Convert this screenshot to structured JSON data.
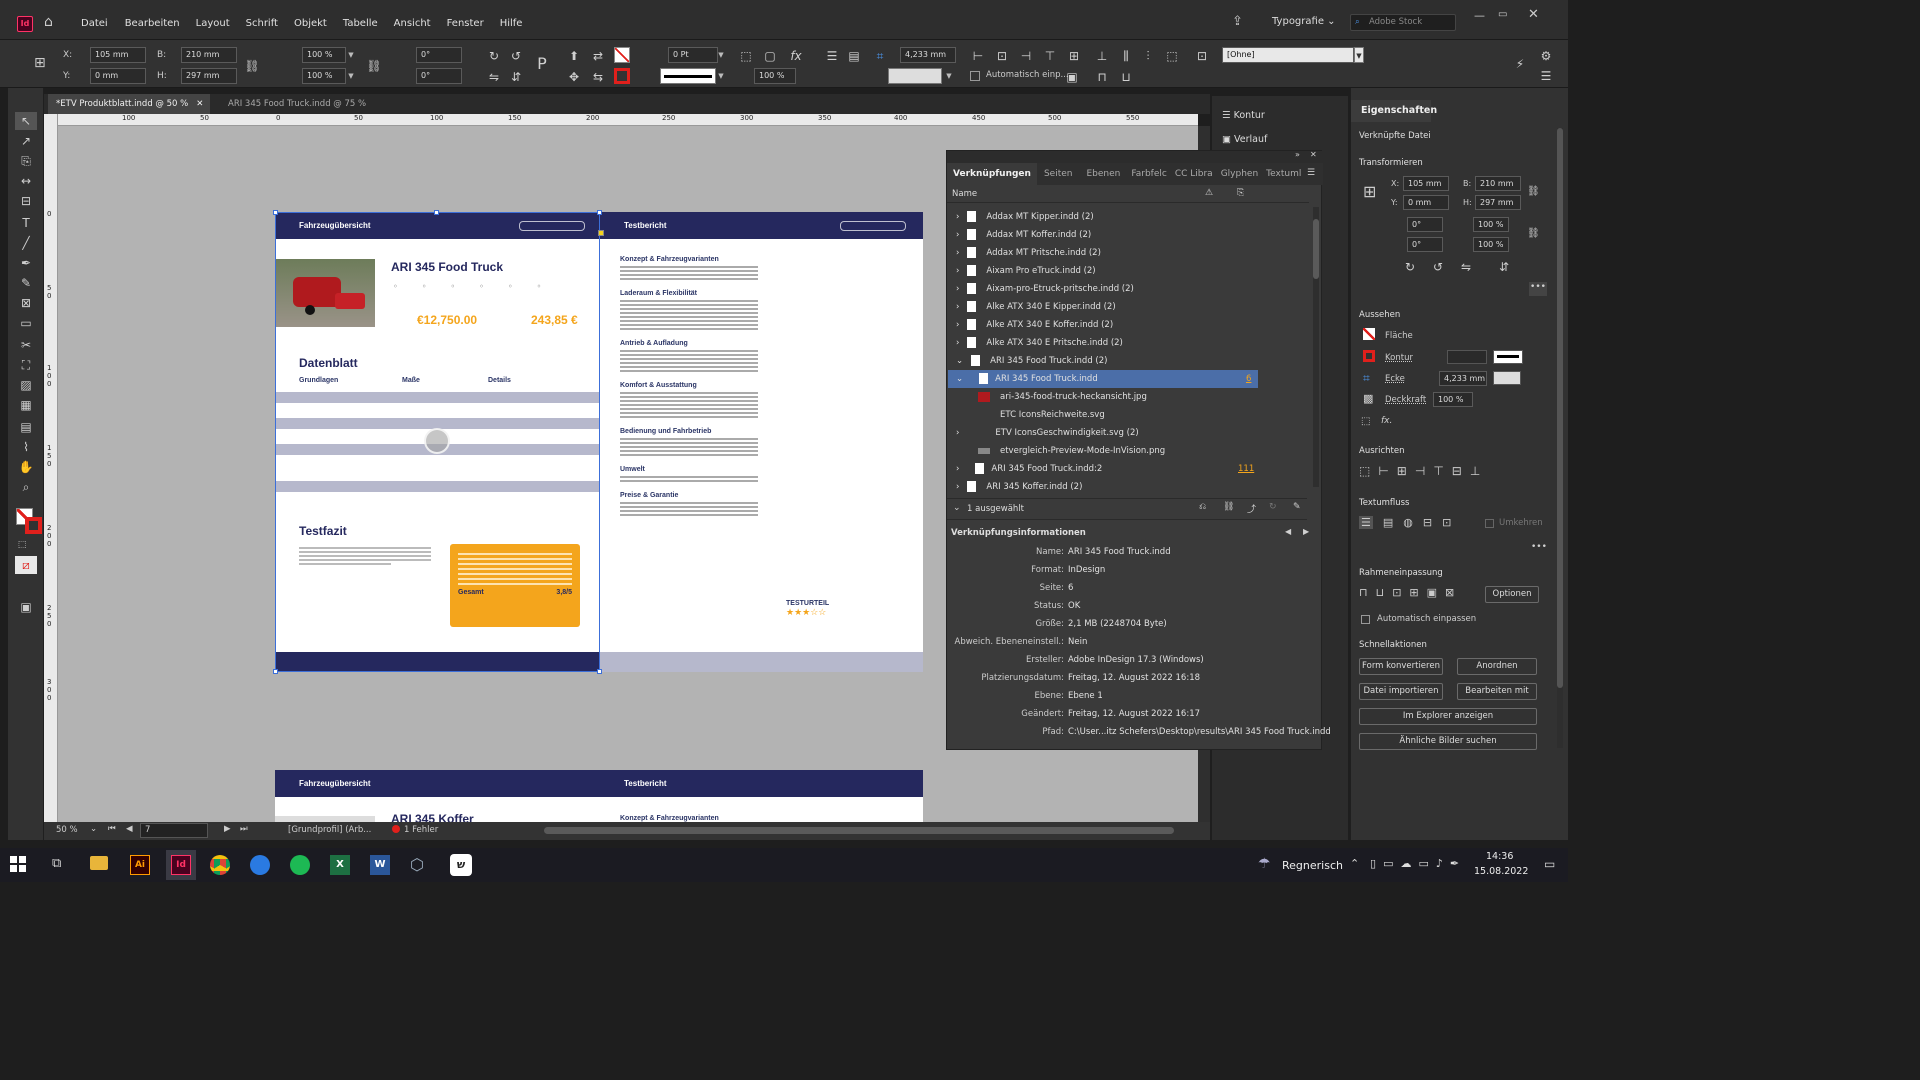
{
  "app": {
    "menu": [
      "Datei",
      "Bearbeiten",
      "Layout",
      "Schrift",
      "Objekt",
      "Tabelle",
      "Ansicht",
      "Fenster",
      "Hilfe"
    ],
    "workspace": "Typografie",
    "stock_placeholder": "Adobe Stock"
  },
  "control": {
    "x_label": "X:",
    "x": "105 mm",
    "y_label": "Y:",
    "y": "0 mm",
    "b_label": "B:",
    "b": "210 mm",
    "h_label": "H:",
    "h": "297 mm",
    "scale_x": "100 %",
    "scale_y": "100 %",
    "angle": "0°",
    "shear": "0°",
    "stroke": "0 Pt",
    "opacity": "100 %",
    "corner": "4,233 mm",
    "style": "[Ohne]",
    "auto_fit": "Automatisch einp..."
  },
  "tabs": [
    {
      "label": "*ETV Produktblatt.indd @ 50 %"
    },
    {
      "label": "ARI 345 Food Truck.indd @ 75 %"
    }
  ],
  "ruler": [
    "100",
    "50",
    "0",
    "50",
    "100",
    "150",
    "200",
    "250",
    "300",
    "350",
    "400",
    "450",
    "500",
    "550"
  ],
  "vruler": [
    "0",
    "5",
    "0",
    "1",
    "0",
    "0",
    "1",
    "5",
    "0",
    "2",
    "0",
    "0",
    "2",
    "5",
    "0",
    "3",
    "0",
    "0"
  ],
  "status": {
    "zoom": "50 %",
    "page": "7",
    "profile": "[Grundprofil] (Arb...",
    "errors": "1 Fehler"
  },
  "links_panel": {
    "tabs": [
      "Verknüpfungen",
      "Seiten",
      "Ebenen",
      "Farbfelc",
      "CC Libra",
      "Glyphen",
      "Textuml"
    ],
    "col_name": "Name",
    "items": [
      {
        "name": "Addax MT Kipper.indd (2)",
        "page": ""
      },
      {
        "name": "Addax MT Koffer.indd (2)",
        "page": ""
      },
      {
        "name": "Addax MT Pritsche.indd (2)",
        "page": ""
      },
      {
        "name": "Aixam Pro eTruck.indd (2)",
        "page": ""
      },
      {
        "name": "Aixam-pro-Etruck-pritsche.indd (2)",
        "page": ""
      },
      {
        "name": "Alke ATX 340 E Kipper.indd (2)",
        "page": ""
      },
      {
        "name": "Alke ATX 340 E Koffer.indd (2)",
        "page": ""
      },
      {
        "name": "Alke ATX 340 E Pritsche.indd (2)",
        "page": ""
      },
      {
        "name": "ARI 345 Food Truck.indd (2)",
        "page": ""
      },
      {
        "name": "ARI 345 Food Truck.indd",
        "page": "6"
      },
      {
        "name": "ari-345-food-truck-heckansicht.jpg",
        "page": ""
      },
      {
        "name": "ETC IconsReichweite.svg",
        "page": ""
      },
      {
        "name": "ETV IconsGeschwindigkeit.svg (2)",
        "page": ""
      },
      {
        "name": "etvergleich-Preview-Mode-InVision.png",
        "page": ""
      },
      {
        "name": "ARI 345 Food Truck.indd:2",
        "page": "111"
      },
      {
        "name": "ARI 345 Koffer.indd (2)",
        "page": ""
      }
    ],
    "selected_count": "1 ausgewählt",
    "info_title": "Verknüpfungsinformationen",
    "info": [
      {
        "k": "Name:",
        "v": "ARI 345 Food Truck.indd"
      },
      {
        "k": "Format:",
        "v": "InDesign"
      },
      {
        "k": "Seite:",
        "v": "6"
      },
      {
        "k": "Status:",
        "v": "OK"
      },
      {
        "k": "Größe:",
        "v": "2,1 MB (2248704 Byte)"
      },
      {
        "k": "Abweich. Ebeneneinstell.:",
        "v": "Nein"
      },
      {
        "k": "Ersteller:",
        "v": "Adobe InDesign 17.3 (Windows)"
      },
      {
        "k": "Platzierungsdatum:",
        "v": "Freitag, 12. August 2022 16:18"
      },
      {
        "k": "Ebene:",
        "v": "Ebene 1"
      },
      {
        "k": "Geändert:",
        "v": "Freitag, 12. August 2022 16:17"
      },
      {
        "k": "Pfad:",
        "v": "C:\\User...itz Schefers\\Desktop\\results\\ARI 345 Food Truck.indd"
      }
    ]
  },
  "mid_panel": {
    "kontur": "Kontur",
    "verlauf": "Verlauf"
  },
  "props": {
    "title": "Eigenschaften",
    "linked_file": "Verknüpfte Datei",
    "transform": "Transformieren",
    "x_label": "X:",
    "x": "105 mm",
    "b_label": "B:",
    "b": "210 mm",
    "y_label": "Y:",
    "y": "0 mm",
    "h_label": "H:",
    "h": "297 mm",
    "angle": "0°",
    "shear": "0°",
    "scale_x": "100 %",
    "scale_y": "100 %",
    "appearance": "Aussehen",
    "fill": "Fläche",
    "stroke": "Kontur",
    "corner": "Ecke",
    "corner_val": "4,233 mm",
    "opacity_label": "Deckkraft",
    "opacity": "100 %",
    "align": "Ausrichten",
    "textflow": "Textumfluss",
    "wrap": "Umkehren",
    "frame_fit": "Rahmeneinpassung",
    "options": "Optionen",
    "auto_fit": "Automatisch einpassen",
    "quick": "Schnellaktionen",
    "q1": "Form konvertieren",
    "q2": "Anordnen",
    "q3": "Datei importieren",
    "q4": "Bearbeiten mit",
    "q5": "Im Explorer anzeigen",
    "q6": "Ähnliche Bilder suchen"
  },
  "doc": {
    "hdr_left": "Fahrzeugübersicht",
    "hdr_right": "Testbericht",
    "title": "ARI 345 Food Truck",
    "price": "€12,750.00",
    "rate": "243,85 €",
    "datasheet": "Datenblatt",
    "col1": "Grundlagen",
    "col2": "Maße",
    "col3": "Details",
    "testfazit": "Testfazit",
    "total_label": "Gesamt",
    "total": "3,8/5",
    "sec1": "Konzept & Fahrzeugvarianten",
    "sec2": "Laderaum & Flexibilität",
    "sec3": "Antrieb & Aufladung",
    "sec4": "Komfort & Ausstattung",
    "sec5": "Bedienung und Fahrbetrieb",
    "sec6": "Umwelt",
    "sec7": "Preise & Garantie",
    "testurteil": "TESTURTEIL",
    "title2": "ARI 345 Koffer"
  },
  "taskbar": {
    "weather": "Regnerisch",
    "time": "14:36",
    "date": "15.08.2022"
  }
}
